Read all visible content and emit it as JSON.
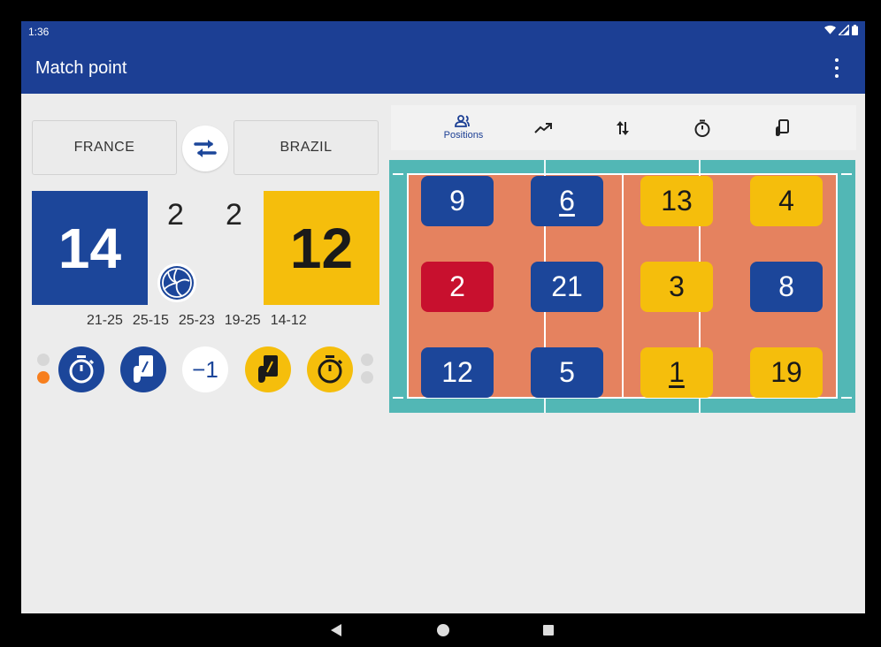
{
  "status_bar": {
    "time": "1:36"
  },
  "app_bar": {
    "title": "Match point"
  },
  "teams": {
    "left": {
      "name": "FRANCE",
      "score": "14",
      "sets": "2",
      "color": "#1c469a"
    },
    "right": {
      "name": "BRAZIL",
      "score": "12",
      "sets": "2",
      "color": "#f5be0c"
    }
  },
  "set_scores": [
    "21-25",
    "25-15",
    "25-23",
    "19-25",
    "14-12"
  ],
  "actions": {
    "undo_label": "−1"
  },
  "tabs": [
    {
      "id": "positions",
      "label": "Positions",
      "icon": "people-icon"
    },
    {
      "id": "trend",
      "icon": "trending-up-icon"
    },
    {
      "id": "substitutions",
      "icon": "swap-vertical-icon"
    },
    {
      "id": "timeouts",
      "icon": "stopwatch-icon"
    },
    {
      "id": "substitution-card",
      "icon": "substitution-card-icon"
    }
  ],
  "court": {
    "left_team": [
      {
        "number": "9",
        "role": "player"
      },
      {
        "number": "6",
        "role": "captain"
      },
      {
        "number": "2",
        "role": "libero"
      },
      {
        "number": "21",
        "role": "player"
      },
      {
        "number": "12",
        "role": "player"
      },
      {
        "number": "5",
        "role": "player"
      }
    ],
    "right_team": [
      {
        "number": "13",
        "role": "player"
      },
      {
        "number": "4",
        "role": "player"
      },
      {
        "number": "3",
        "role": "player"
      },
      {
        "number": "8",
        "role": "libero"
      },
      {
        "number": "1",
        "role": "captain"
      },
      {
        "number": "19",
        "role": "player"
      }
    ]
  }
}
